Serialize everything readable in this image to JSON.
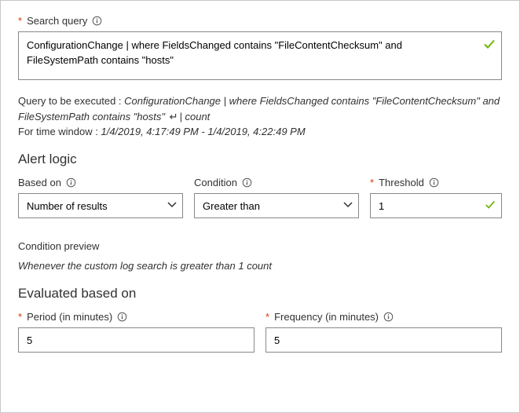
{
  "searchQuery": {
    "label": "Search query",
    "value": "ConfigurationChange | where FieldsChanged contains \"FileContentChecksum\" and FileSystemPath contains \"hosts\""
  },
  "execPreview": {
    "prefix": "Query to be executed : ",
    "queryItalic": "ConfigurationChange | where FieldsChanged contains \"FileContentChecksum\" and FileSystemPath contains \"hosts\" ",
    "countItalic": "| count",
    "timePrefix": "For time window : ",
    "timeValue": "1/4/2019, 4:17:49 PM - 1/4/2019, 4:22:49 PM"
  },
  "alertLogic": {
    "heading": "Alert logic",
    "basedOnLabel": "Based on",
    "basedOnValue": "Number of results",
    "conditionLabel": "Condition",
    "conditionValue": "Greater than",
    "thresholdLabel": "Threshold",
    "thresholdValue": "1"
  },
  "conditionPreview": {
    "label": "Condition preview",
    "text": "Whenever the custom log search is greater than 1 count"
  },
  "evaluated": {
    "heading": "Evaluated based on",
    "periodLabel": "Period (in minutes)",
    "periodValue": "5",
    "frequencyLabel": "Frequency (in minutes)",
    "frequencyValue": "5"
  }
}
